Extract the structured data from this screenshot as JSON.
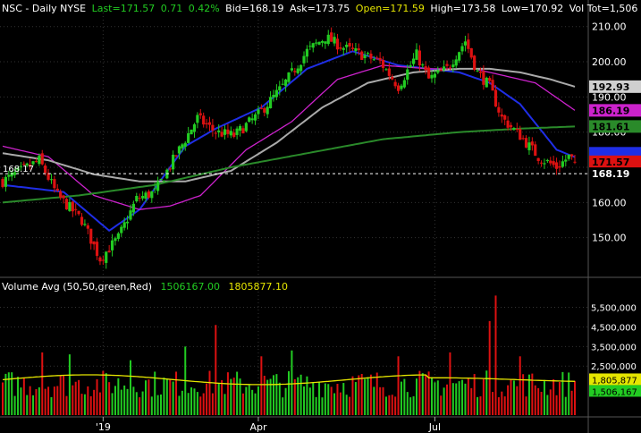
{
  "header": {
    "symbol": "NSC - Daily  NYSE",
    "last": "Last=171.57",
    "change": "0.71",
    "change_pct": "0.42%",
    "bid": "Bid=168.19",
    "ask": "Ask=173.75",
    "open": "Open=171.59",
    "high": "High=173.58",
    "low": "Low=170.92",
    "vol_tot": "Vol Tot=1,506"
  },
  "volume_header": {
    "title": "Volume Avg (50,50,green,Red)",
    "value1": "1506167.00",
    "value2": "1805877.10"
  },
  "colors": {
    "up": "#22cc22",
    "down": "#dd1111",
    "ma_fast": "#1f2ee6",
    "ma_mid": "#cc22cc",
    "ma_slow": "#aaaaaa",
    "ma_long": "#2a8a2a",
    "avg_volume": "#e6e600",
    "grid": "#333333",
    "dashed": "#ffffff"
  },
  "chart_data": [
    {
      "type": "candlestick",
      "title": "NSC - Daily NYSE",
      "x_tick_labels": [
        "'19",
        "Apr",
        "Jul"
      ],
      "y_tick_labels": [
        "150.00",
        "160.00",
        "170.00",
        "180.00",
        "190.00",
        "200.00",
        "210.00"
      ],
      "ylim": [
        140,
        214
      ],
      "dashed_level": 168.19,
      "dashed_label": "168.17",
      "grid": true,
      "key_prices": [
        {
          "t": 0,
          "p": 166
        },
        {
          "t": 12,
          "p": 172
        },
        {
          "t": 18,
          "p": 162
        },
        {
          "t": 26,
          "p": 155
        },
        {
          "t": 32,
          "p": 144
        },
        {
          "t": 38,
          "p": 150
        },
        {
          "t": 44,
          "p": 161
        },
        {
          "t": 50,
          "p": 163
        },
        {
          "t": 58,
          "p": 175
        },
        {
          "t": 64,
          "p": 184
        },
        {
          "t": 70,
          "p": 180
        },
        {
          "t": 76,
          "p": 179
        },
        {
          "t": 84,
          "p": 185
        },
        {
          "t": 92,
          "p": 193
        },
        {
          "t": 100,
          "p": 203
        },
        {
          "t": 106,
          "p": 207
        },
        {
          "t": 112,
          "p": 204
        },
        {
          "t": 118,
          "p": 202
        },
        {
          "t": 124,
          "p": 200
        },
        {
          "t": 130,
          "p": 193
        },
        {
          "t": 136,
          "p": 202
        },
        {
          "t": 140,
          "p": 195
        },
        {
          "t": 146,
          "p": 198
        },
        {
          "t": 152,
          "p": 206
        },
        {
          "t": 156,
          "p": 197
        },
        {
          "t": 160,
          "p": 193
        },
        {
          "t": 164,
          "p": 184
        },
        {
          "t": 170,
          "p": 179
        },
        {
          "t": 176,
          "p": 173
        },
        {
          "t": 182,
          "p": 170
        },
        {
          "t": 186,
          "p": 173
        },
        {
          "t": 188,
          "p": 171.57
        }
      ],
      "moving_averages": [
        {
          "name": "ma_fast",
          "last": 172.9,
          "points": [
            [
              0,
              165
            ],
            [
              20,
              163
            ],
            [
              35,
              152
            ],
            [
              45,
              158
            ],
            [
              60,
              176
            ],
            [
              70,
              181
            ],
            [
              85,
              187
            ],
            [
              100,
              198
            ],
            [
              115,
              203
            ],
            [
              130,
              199
            ],
            [
              150,
              197
            ],
            [
              160,
              194
            ],
            [
              170,
              188
            ],
            [
              182,
              175
            ],
            [
              188,
              172.9
            ]
          ]
        },
        {
          "name": "ma_mid",
          "last": 186.19,
          "points": [
            [
              0,
              176
            ],
            [
              15,
              173
            ],
            [
              30,
              162
            ],
            [
              45,
              158
            ],
            [
              55,
              159
            ],
            [
              65,
              162
            ],
            [
              80,
              175
            ],
            [
              95,
              183
            ],
            [
              110,
              195
            ],
            [
              125,
              199
            ],
            [
              140,
              198
            ],
            [
              155,
              198
            ],
            [
              165,
              196
            ],
            [
              175,
              194
            ],
            [
              188,
              186.19
            ]
          ]
        },
        {
          "name": "ma_slow",
          "last": 192.93,
          "points": [
            [
              0,
              174
            ],
            [
              15,
              172
            ],
            [
              30,
              168
            ],
            [
              45,
              166
            ],
            [
              60,
              166
            ],
            [
              75,
              169
            ],
            [
              90,
              177
            ],
            [
              105,
              187
            ],
            [
              120,
              194
            ],
            [
              135,
              197
            ],
            [
              150,
              198
            ],
            [
              160,
              198
            ],
            [
              170,
              197
            ],
            [
              180,
              195
            ],
            [
              188,
              192.93
            ]
          ]
        },
        {
          "name": "ma_long",
          "last": 181.61,
          "points": [
            [
              0,
              160
            ],
            [
              25,
              162
            ],
            [
              50,
              165
            ],
            [
              75,
              170
            ],
            [
              100,
              174
            ],
            [
              125,
              178
            ],
            [
              150,
              180
            ],
            [
              170,
              181
            ],
            [
              188,
              181.61
            ]
          ]
        }
      ],
      "price_labels": [
        {
          "value": "192.93",
          "price": 192.93,
          "bg": "#cfcfcf",
          "fg": "#000000"
        },
        {
          "value": "186.19",
          "price": 186.19,
          "bg": "#cc22cc",
          "fg": "#000000"
        },
        {
          "value": "181.61",
          "price": 181.61,
          "bg": "#2a8a2a",
          "fg": "#000000"
        },
        {
          "value": "173.75",
          "price": 174.0,
          "bg": "#1f2ee6",
          "fg": "#1f2ee6"
        },
        {
          "value": "171.57",
          "price": 171.57,
          "bg": "#dd1111",
          "fg": "#000000"
        },
        {
          "value": "168.19",
          "price": 168.19,
          "bg": "#000000",
          "fg": "#ffffff"
        }
      ]
    },
    {
      "type": "bar",
      "title": "Volume Avg (50,50,green,Red)",
      "y_tick_labels": [
        "2,500,000",
        "3,500,000",
        "4,500,000",
        "5,500,000"
      ],
      "ylim": [
        0,
        6300000
      ],
      "avg_level": 1805877,
      "avg_label": "1,805,877",
      "last_label": "1,506,167",
      "spikes": [
        {
          "t": 13,
          "v": 3200000
        },
        {
          "t": 22,
          "v": 3100000
        },
        {
          "t": 42,
          "v": 2800000
        },
        {
          "t": 60,
          "v": 3500000
        },
        {
          "t": 70,
          "v": 4600000
        },
        {
          "t": 85,
          "v": 3000000
        },
        {
          "t": 95,
          "v": 3300000
        },
        {
          "t": 130,
          "v": 3000000
        },
        {
          "t": 147,
          "v": 3200000
        },
        {
          "t": 160,
          "v": 4800000
        },
        {
          "t": 162,
          "v": 6100000
        },
        {
          "t": 170,
          "v": 3000000
        }
      ]
    }
  ]
}
